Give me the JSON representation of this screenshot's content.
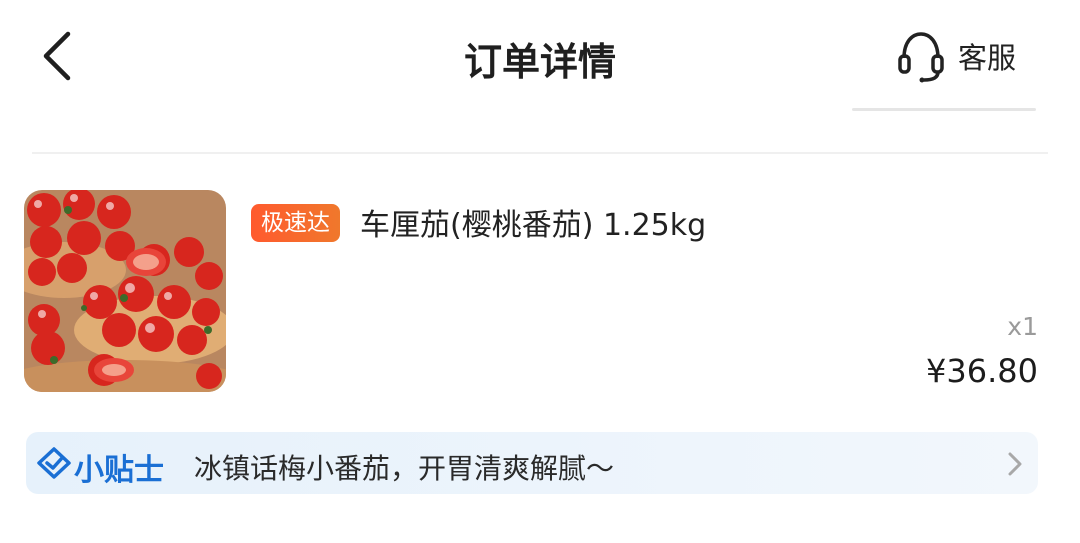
{
  "header": {
    "title": "订单详情",
    "service_label": "客服"
  },
  "product": {
    "badge": "极速达",
    "name": "车厘茄(樱桃番茄) 1.25kg",
    "quantity": "x1",
    "price": "¥36.80"
  },
  "tip": {
    "title": "小贴士",
    "text": "冰镇话梅小番茄，开胃清爽解腻～"
  },
  "colors": {
    "badge": "#f2652d",
    "tip_accent": "#1a6fd4",
    "tip_background": "#e9f2fb"
  }
}
